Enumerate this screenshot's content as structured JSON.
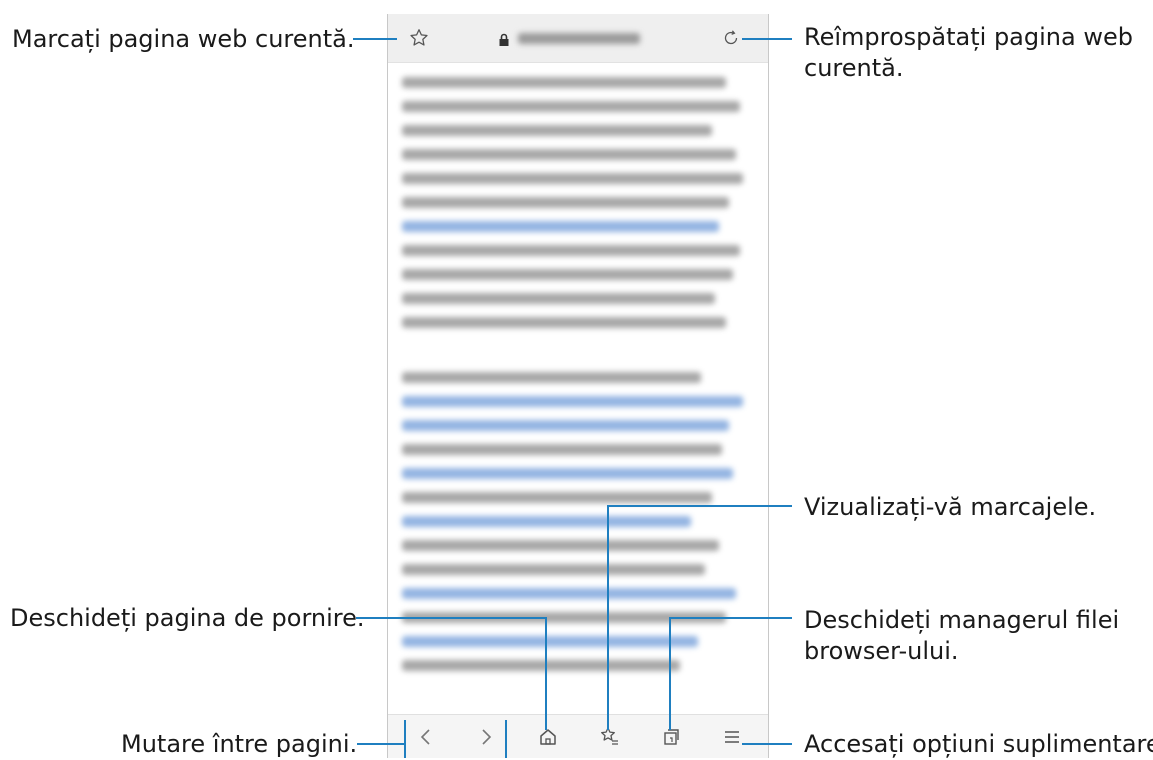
{
  "callouts": {
    "bookmark_current": "Marcați pagina web curentă.",
    "refresh_line1": "Reîmprospătați pagina web",
    "refresh_line2": "curentă.",
    "view_bookmarks": "Vizualizați-vă marcajele.",
    "open_home": "Deschideți pagina de pornire.",
    "tab_manager_line1": "Deschideți managerul filei",
    "tab_manager_line2": "browser-ului.",
    "navigate_pages": "Mutare între pagini.",
    "more_options": "Accesați opțiuni suplimentare."
  },
  "colors": {
    "callout_line": "#1f7fc0",
    "link_text": "#6f9bd8"
  },
  "icons": {
    "top_left": "star-outline-icon",
    "url_lock": "lock-icon",
    "top_right": "refresh-icon",
    "back": "chevron-left-icon",
    "forward": "chevron-right-icon",
    "home": "home-icon",
    "bookmarks": "bookmarks-list-icon",
    "tabs": "tabs-icon",
    "menu": "hamburger-menu-icon"
  }
}
